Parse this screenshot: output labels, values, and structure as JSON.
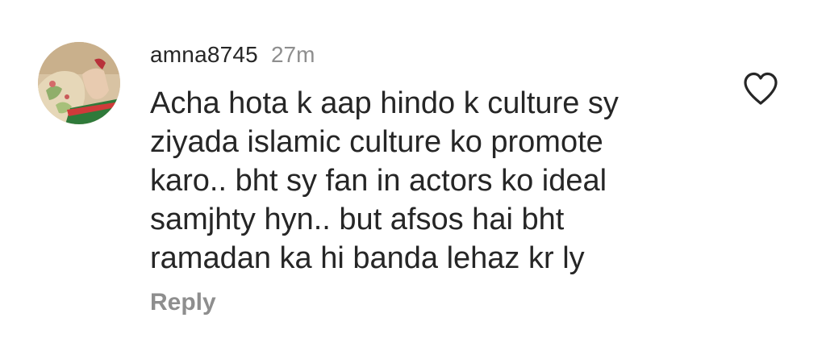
{
  "comment": {
    "username": "amna8745",
    "timestamp": "27m",
    "text_lines": [
      "Acha hota k aap hindo k culture sy",
      "ziyada islamic culture ko promote",
      "karo.. bht sy fan in actors ko ideal",
      "samjhty hyn.. but afsos hai bht",
      "ramadan ka hi banda lehaz kr ly"
    ],
    "reply_label": "Reply",
    "like_icon": "heart-outline-icon"
  },
  "colors": {
    "text_primary": "#262626",
    "text_secondary": "#8e8e8e",
    "background": "#ffffff"
  }
}
